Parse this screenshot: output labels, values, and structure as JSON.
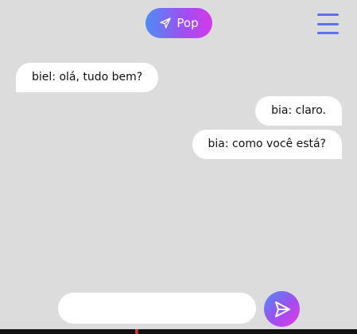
{
  "header": {
    "pop_label": "Pop",
    "pop_icon": "send-outline-icon",
    "menu_icon": "hamburger-menu-icon",
    "gradient_colors": [
      "#4f8cf5",
      "#a24df2",
      "#d43ae8"
    ]
  },
  "messages": [
    {
      "side": "left",
      "text": "biel: olá, tudo bem?"
    },
    {
      "side": "right",
      "text": "bia: claro."
    },
    {
      "side": "right",
      "text": "bia: como você está?"
    }
  ],
  "composer": {
    "value": "",
    "placeholder": "",
    "send_icon": "send-icon"
  },
  "colors": {
    "background": "#dcdcdc",
    "bubble": "#ffffff",
    "menu_accent": "#5b72f0"
  }
}
